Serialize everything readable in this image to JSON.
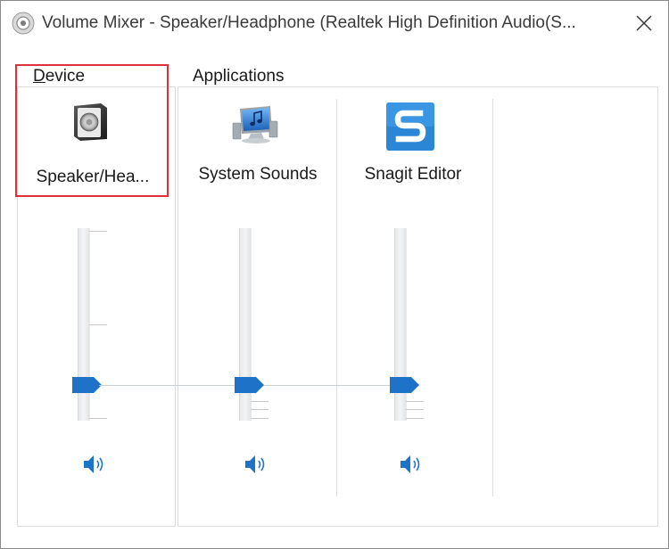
{
  "window": {
    "title": "Volume Mixer - Speaker/Headphone (Realtek High Definition Audio(S..."
  },
  "device_group": {
    "label_underlined": "D",
    "label_rest": "evice",
    "device_name": "Speaker/Hea...",
    "icon": "speaker-box-icon",
    "volume_percent": 20
  },
  "applications_group": {
    "label": "Applications",
    "apps": [
      {
        "name": "System Sounds",
        "icon": "system-sounds-icon",
        "volume_percent": 20
      },
      {
        "name": "Snagit Editor",
        "icon": "snagit-logo-icon",
        "volume_percent": 20
      }
    ]
  },
  "colors": {
    "accent": "#1e73c8",
    "highlight": "#e0303a",
    "frame": "#dcdcdc"
  }
}
